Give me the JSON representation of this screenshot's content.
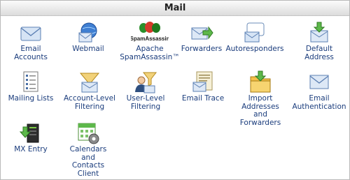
{
  "panel": {
    "title": "Mail"
  },
  "items": [
    {
      "label": "Email\nAccounts",
      "icon": "email-accounts-icon"
    },
    {
      "label": "Webmail",
      "icon": "webmail-icon"
    },
    {
      "label": "Apache\nSpamAssassin™",
      "icon": "spamassassin-icon",
      "logo_text": "SpamAssassin"
    },
    {
      "label": "Forwarders",
      "icon": "forwarders-icon"
    },
    {
      "label": "Autoresponders",
      "icon": "autoresponders-icon"
    },
    {
      "label": "Default\nAddress",
      "icon": "default-address-icon"
    },
    {
      "label": "Mailing Lists",
      "icon": "mailing-lists-icon"
    },
    {
      "label": "Account-Level\nFiltering",
      "icon": "account-filtering-icon"
    },
    {
      "label": "User-Level\nFiltering",
      "icon": "user-filtering-icon"
    },
    {
      "label": "Email Trace",
      "icon": "email-trace-icon"
    },
    {
      "label": "Import\nAddresses\nand\nForwarders",
      "icon": "import-icon"
    },
    {
      "label": "Email\nAuthentication",
      "icon": "email-authentication-icon"
    },
    {
      "label": "MX Entry",
      "icon": "mx-entry-icon"
    },
    {
      "label": "Calendars\nand\nContacts\nClient",
      "icon": "calendar-icon"
    }
  ]
}
